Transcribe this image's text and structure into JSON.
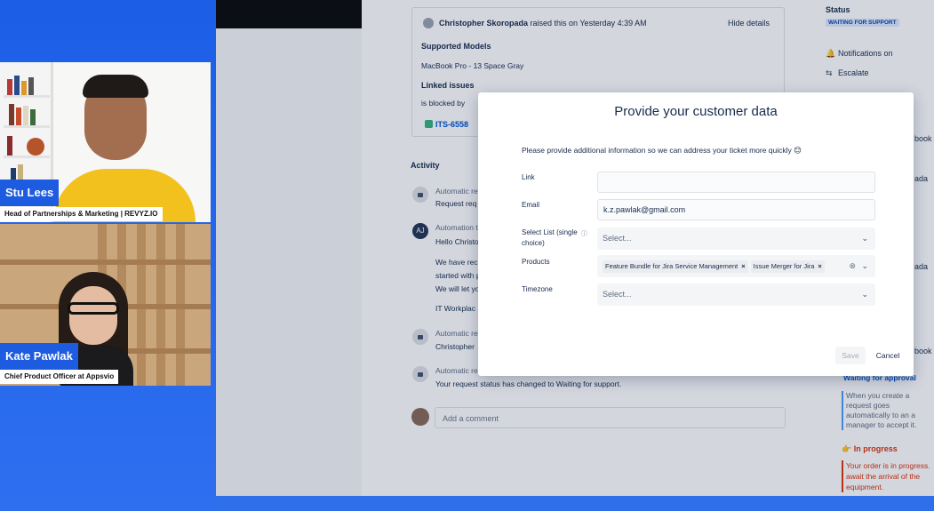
{
  "video": {
    "host": {
      "name": "Stu Lees",
      "role": "Head of Partnerships & Marketing | REVYZ.IO"
    },
    "guest": {
      "name": "Kate Pawlak",
      "role": "Chief Product Officer at Appsvio"
    }
  },
  "request": {
    "reporter": "Christopher Skoropada",
    "raised_text": " raised this on Yesterday 4:39 AM",
    "hide_details": "Hide details",
    "supported_models_label": "Supported Models",
    "supported_models_value": "MacBook Pro - 13 Space Gray",
    "linked_issues_label": "Linked issues",
    "blocked_by": "is blocked by",
    "linked_issue": "ITS-6558"
  },
  "activity": {
    "title": "Activity",
    "items": [
      {
        "line1": "Automatic re",
        "line2": "Request req"
      },
      {
        "avatar": "AJ",
        "line1": "Automation t",
        "line2": "Hello Christo"
      },
      {
        "line1": "We have rec",
        "line2": "started with p",
        "line3": "We will let yo"
      },
      {
        "line1": "IT Workplac"
      },
      {
        "line1": "Automatic re",
        "line2": "Christopher"
      },
      {
        "line1": "Automatic re",
        "line2": "Your request status has changed to Waiting for support."
      }
    ],
    "comment_placeholder": "Add a comment"
  },
  "sidebar": {
    "status_label": "Status",
    "status_value": "WAITING FOR SUPPORT",
    "notifications": "Notifications on",
    "escalate": "Escalate",
    "peek_1": "book",
    "peek_2": "ada",
    "peek_3": "ada",
    "peek_4": "book li",
    "approval_title": "Waiting for approval",
    "approval_text": "When you create a request goes automatically to an a manager to accept it.",
    "inprogress_title": "In progress",
    "inprogress_text": "Your order is in progress. await the arrival of the equipment."
  },
  "modal": {
    "title": "Provide your customer data",
    "intro": "Please provide additional information so we can address your ticket more quickly 😊",
    "fields": {
      "link_label": "Link",
      "link_value": "",
      "email_label": "Email",
      "email_value": "k.z.pawlak@gmail.com",
      "select_list_label": "Select List (single choice)",
      "select_list_placeholder": "Select...",
      "products_label": "Products",
      "products_tags": [
        "Feature Bundle for Jira Service Management",
        "Issue Merger for Jira"
      ],
      "timezone_label": "Timezone",
      "timezone_placeholder": "Select..."
    },
    "save": "Save",
    "cancel": "Cancel"
  },
  "colors": {
    "brand_blue": "#1d5be0",
    "link_blue": "#0052cc",
    "status_bg": "#deebff",
    "danger": "#de350b"
  }
}
